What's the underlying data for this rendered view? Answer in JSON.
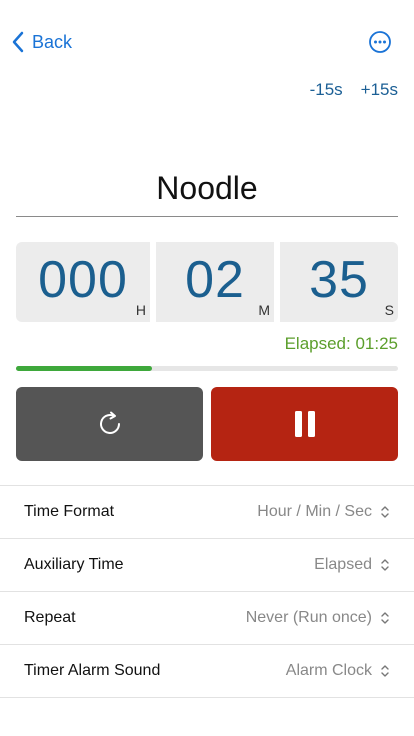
{
  "nav": {
    "back_label": "Back",
    "more_icon": "ellipsis-circle-icon"
  },
  "adjust": {
    "minus_label": "-15s",
    "plus_label": "+15s"
  },
  "timer": {
    "name": "Noodle",
    "hours": "000",
    "hours_unit": "H",
    "minutes": "02",
    "minutes_unit": "M",
    "seconds": "35",
    "seconds_unit": "S",
    "elapsed_label": "Elapsed: 01:25",
    "progress_fraction": 0.355
  },
  "controls": {
    "reset_icon": "reset-icon",
    "pause_icon": "pause-icon"
  },
  "settings": [
    {
      "label": "Time Format",
      "value": "Hour / Min / Sec"
    },
    {
      "label": "Auxiliary Time",
      "value": "Elapsed"
    },
    {
      "label": "Repeat",
      "value": "Never (Run once)"
    },
    {
      "label": "Timer Alarm Sound",
      "value": "Alarm Clock"
    }
  ],
  "colors": {
    "accent_blue": "#1a73d6",
    "digit_blue": "#1b5f8f",
    "elapsed_green": "#5b9e2b",
    "progress_green": "#3ea83b",
    "reset_gray": "#555555",
    "pause_red": "#b52412"
  }
}
